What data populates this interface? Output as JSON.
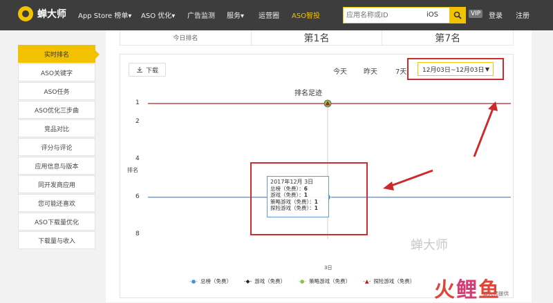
{
  "nav": {
    "logo_text": "蝉大师",
    "items": [
      "App Store 榜单▾",
      "ASO 优化▾",
      "广告监测",
      "服务▾",
      "运营圈",
      "ASO智投"
    ],
    "search_placeholder": "应用名称或ID",
    "platform": "iOS",
    "vip": "VIP",
    "login": "登录",
    "register": "注册"
  },
  "sidebar": {
    "items": [
      "实时排名",
      "ASO关键字",
      "ASO任务",
      "ASO优化三步曲",
      "竞品对比",
      "评分与评论",
      "应用信息与版本",
      "同开发商应用",
      "您可能还喜欢",
      "ASO下载量优化",
      "下载量与收入"
    ]
  },
  "rank_row": [
    "今日排名",
    "第1名",
    "第7名"
  ],
  "toolbar": {
    "download": "下载",
    "periods": [
      "今天",
      "昨天",
      "7天"
    ],
    "date_range": "12月03日~12月03日"
  },
  "chart_data": {
    "type": "line",
    "title": "排名足迹",
    "ylabel": "排名",
    "x": [
      "3日"
    ],
    "yticks": [
      1,
      2,
      4,
      6,
      8
    ],
    "ylim": [
      8,
      1
    ],
    "series": [
      {
        "name": "总榜（免费）",
        "values": [
          6
        ],
        "color": "#4a8fd9"
      },
      {
        "name": "游戏（免费）",
        "values": [
          null
        ],
        "color": "#222222"
      },
      {
        "name": "策略游戏（免费）",
        "values": [
          1
        ],
        "color": "#8bc34a"
      },
      {
        "name": "探险游戏（免费）",
        "values": [
          1
        ],
        "color": "#b22222"
      }
    ]
  },
  "tooltip": {
    "date": "2017年12月 3日",
    "rows": [
      {
        "label": "总榜（免费）：",
        "value": "6"
      },
      {
        "label": "游戏（免费）：",
        "value": "1"
      },
      {
        "label": "策略游戏（免费）：",
        "value": "1"
      },
      {
        "label": "探险游戏（免费）：",
        "value": "1"
      }
    ]
  },
  "credit": "蝉大师提供",
  "watermark": "蝉大师",
  "footer_brand": [
    "火",
    "鲤",
    "鱼"
  ],
  "colors": {
    "accent": "#f2c100",
    "nav_bg": "#3d3d3d",
    "annotation": "#cc2b2b"
  }
}
